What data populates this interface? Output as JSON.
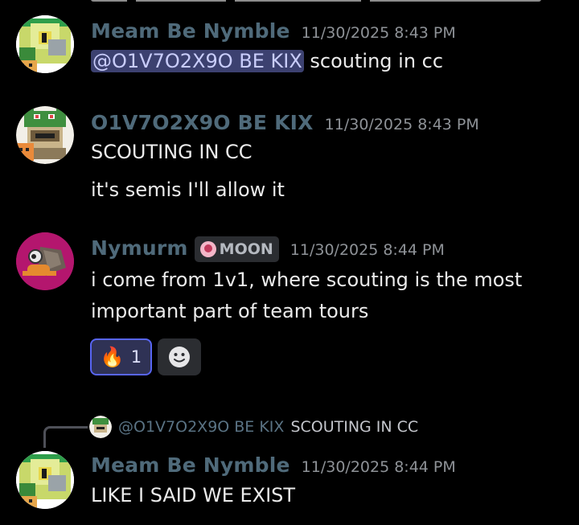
{
  "messages": [
    {
      "author": "Meam Be Nymble",
      "timestamp": "11/30/2025 8:43 PM",
      "mention": "@O1V7O2X9O BE KIX",
      "text": "scouting in cc"
    },
    {
      "author": "O1V7O2X9O BE KIX",
      "timestamp": "11/30/2025 8:43 PM",
      "lines": [
        "SCOUTING IN CC",
        "it's semis I'll allow it"
      ]
    },
    {
      "author": "Nymurm",
      "badge": "MOON",
      "timestamp": "11/30/2025 8:44 PM",
      "lines": [
        "i come from 1v1, where scouting is the most",
        "important part of team tours"
      ],
      "reaction": {
        "emoji": "🔥",
        "count": "1"
      }
    },
    {
      "reply_to": {
        "author": "@O1V7O2X9O BE KIX",
        "text": "SCOUTING IN CC"
      },
      "author": "Meam Be Nymble",
      "timestamp": "11/30/2025 8:44 PM",
      "text": "LIKE I SAID WE EXIST"
    }
  ],
  "colors": {
    "background": "#000000",
    "author": "#4f6a7a",
    "mention_bg": "#3c4170",
    "reaction_border": "#5865f2"
  },
  "icons": [
    "add-reaction-icon",
    "moon-badge-icon",
    "fire-emoji-icon"
  ]
}
